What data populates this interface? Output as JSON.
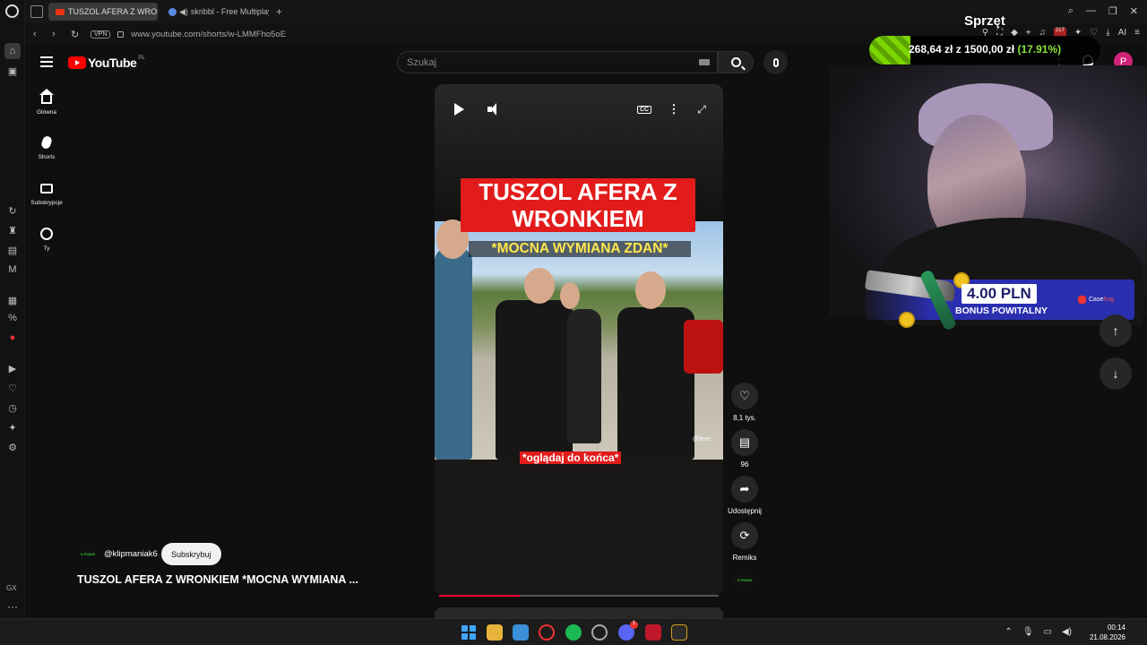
{
  "browser": {
    "tabs": [
      {
        "label": "TUSZOL AFERA Z WRONKI",
        "active": true
      },
      {
        "label": "skribbl - Free Multiplaye",
        "active": false
      }
    ],
    "url": "www.youtube.com/shorts/w-LMMFho5oE",
    "vpn_label": "VPN",
    "ext_badge": "217",
    "ai_label": "AI",
    "gx_label": "GX"
  },
  "youtube": {
    "logo_text": "YouTube",
    "region": "PL",
    "search_placeholder": "Szukaj",
    "avatar_letter": "P",
    "nav": [
      {
        "label": "Główna",
        "icon": "home-icon"
      },
      {
        "label": "Shorts",
        "icon": "shorts-icon"
      },
      {
        "label": "Subskrypcje",
        "icon": "subscriptions-icon"
      },
      {
        "label": "Ty",
        "icon": "you-icon"
      }
    ]
  },
  "video": {
    "caption_main": "TUSZOL AFERA Z WRONKIEM",
    "caption_sub": "*MOCNA WYMIANA ZDAŃ*",
    "caption_bottom": "*oglądaj do końca*",
    "watermark": "@leve",
    "progress": 0.29,
    "cc_label": "CC"
  },
  "actions": {
    "likes": "8,1 tys.",
    "comments": "96",
    "share": "Udostępnij",
    "remix": "Remiks"
  },
  "channel": {
    "handle": "@klipmaniak6",
    "subscribe": "Subskrybuj",
    "avatar_text": "K.PMANI",
    "title": "TUSZOL AFERA Z WRONKIEM *MOCNA WYMIANA ..."
  },
  "overlay": {
    "budget_title": "Sprzęt",
    "budget_current": "268,64 zł",
    "budget_sep": "z",
    "budget_goal": "1500,00 zł",
    "budget_pct": "(17.91%)",
    "budget_fraction": 0.1791,
    "promo_amount": "4.00 PLN",
    "promo_sub": "BONUS POWITALNY",
    "promo_brand_a": "Case",
    "promo_brand_b": "hug"
  },
  "taskbar": {
    "time": "00:14",
    "date": "21.08.2026",
    "discord_badge": "1"
  },
  "colors": {
    "accent_red": "#ff0000",
    "budget_green": "#7cd600",
    "promo_blue": "#2a2fb0",
    "avatar_pink": "#d02377"
  }
}
